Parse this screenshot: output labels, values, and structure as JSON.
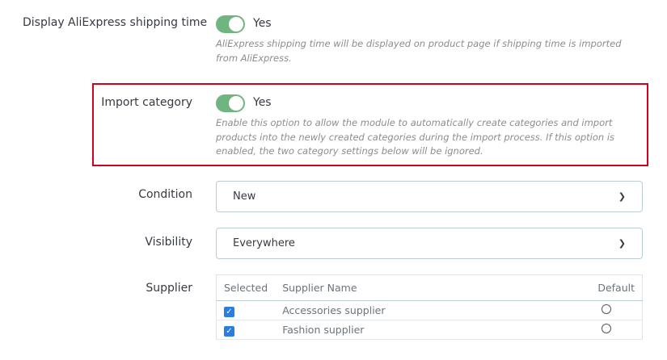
{
  "shipping_time": {
    "label": "Display AliExpress shipping time",
    "value": "Yes",
    "help": "AliExpress shipping time will be displayed on product page if shipping time is imported from AliExpress."
  },
  "import_category": {
    "label": "Import category",
    "value": "Yes",
    "help": "Enable this option to allow the module to automatically create categories and import products into the newly created categories during the import process. If this option is enabled, the two category settings below will be ignored."
  },
  "condition": {
    "label": "Condition",
    "value": "New"
  },
  "visibility": {
    "label": "Visibility",
    "value": "Everywhere"
  },
  "supplier": {
    "label": "Supplier",
    "headers": [
      "Selected",
      "Supplier Name",
      "Default"
    ],
    "rows": [
      {
        "name": "Accessories supplier",
        "selected": true,
        "default": false
      },
      {
        "name": "Fashion supplier",
        "selected": true,
        "default": false
      }
    ]
  },
  "colors": {
    "toggle": "#70b580",
    "highlight": "#d0021b",
    "checkbox": "#2a7de1"
  }
}
